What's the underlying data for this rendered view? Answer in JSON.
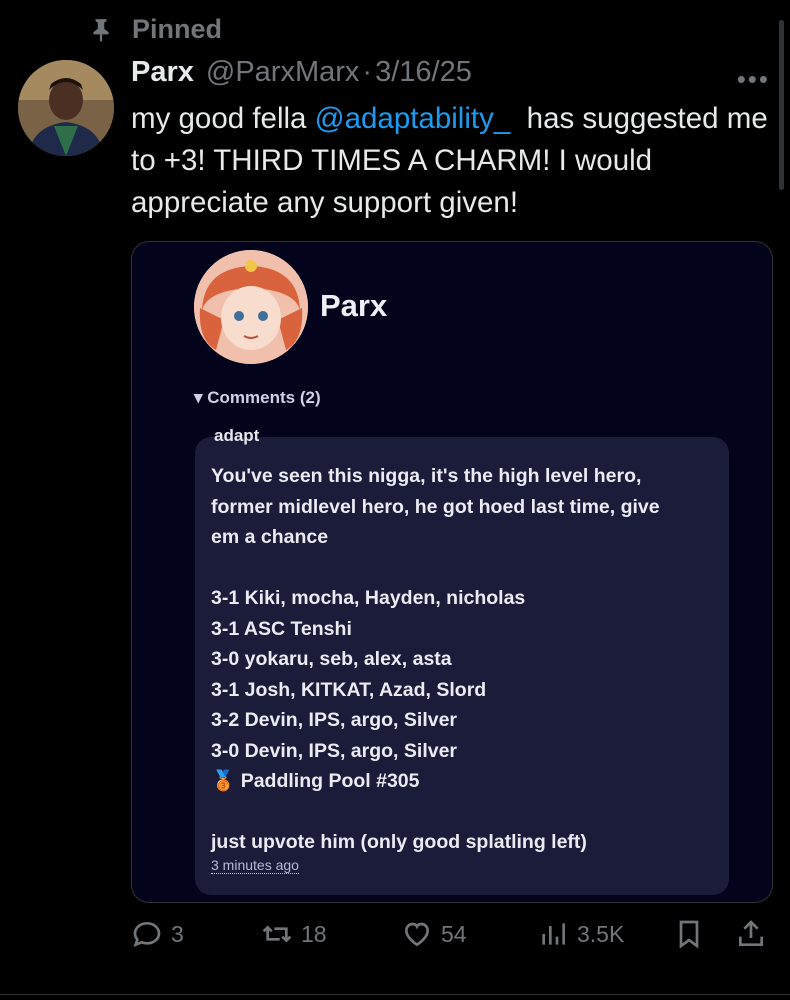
{
  "pinned_label": "Pinned",
  "author": {
    "name": "Parx",
    "handle": "@ParxMarx",
    "separator": "·",
    "date": "3/16/25"
  },
  "more_label": "•••",
  "body": {
    "part1": "my good fella ",
    "mention": "@adaptability_",
    "part2": "  has suggested me to +3! THIRD TIMES A CHARM! I would appreciate any support given!"
  },
  "card": {
    "profile_name": "Parx",
    "comments_toggle": "▾ Comments (2)",
    "comment": {
      "author": "adapt",
      "text": "You've seen this nigga, it's the high level hero,\nformer midlevel hero, he got hoed last time, give\nem a chance\n\n3-1 Kiki, mocha, Hayden, nicholas\n3-1 ASC Tenshi\n3-0 yokaru, seb, alex, asta\n3-1 Josh, KITKAT, Azad, Slord\n3-2 Devin, IPS, argo, Silver\n3-0 Devin, IPS, argo, Silver\n🥉 Paddling Pool #305\n\njust upvote him (only good splatling left)",
      "time": "3 minutes ago"
    }
  },
  "actions": {
    "replies": "3",
    "reposts": "18",
    "likes": "54",
    "views": "3.5K"
  },
  "colors": {
    "accent": "#1d9bf0",
    "muted": "#71767b",
    "card_bg": "#03031c",
    "comment_bg": "#1b1b3a"
  }
}
